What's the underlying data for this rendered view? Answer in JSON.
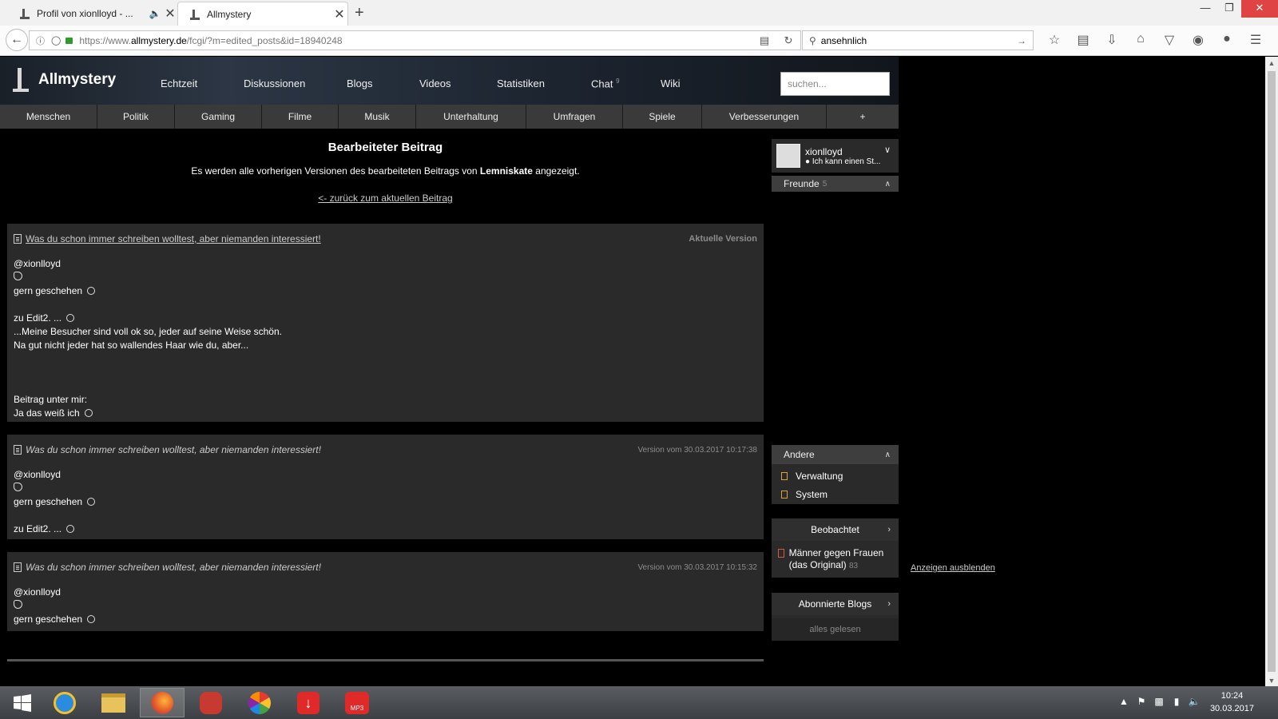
{
  "browser": {
    "tabs": [
      {
        "title": "Profil von xionlloyd - ...",
        "active": false
      },
      {
        "title": "Allmystery",
        "active": true
      }
    ],
    "url_prefix": "https://www.",
    "url_domain": "allmystery.de",
    "url_path": "/fcgi/?m=edited_posts&id=18940248",
    "search_value": "ansehnlich"
  },
  "site": {
    "logo": "Allmystery",
    "nav": [
      "Echtzeit",
      "Diskussionen",
      "Blogs",
      "Videos",
      "Statistiken",
      "Chat",
      "Wiki"
    ],
    "chat_count": "9",
    "search_placeholder": "suchen...",
    "categories": [
      "Menschen",
      "Politik",
      "Gaming",
      "Filme",
      "Musik",
      "Unterhaltung",
      "Umfragen",
      "Spiele",
      "Verbesserungen",
      "+"
    ]
  },
  "main": {
    "heading": "Bearbeiteter Beitrag",
    "info_before": "Es werden alle vorherigen Versionen des bearbeiteten Beitrags von ",
    "info_user": "Lemniskate",
    "info_after": " angezeigt.",
    "back_link": "<- zurück zum aktuellen Beitrag"
  },
  "posts": [
    {
      "title": "Was du schon immer schreiben wolltest, aber niemanden interessiert!",
      "version": "Aktuelle Version",
      "lines": [
        "@xionlloyd",
        "",
        "gern geschehen",
        "",
        "zu Edit2. ...",
        "...Meine Besucher sind voll ok so, jeder auf seine Weise schön.",
        "Na gut nicht jeder hat so wallendes Haar wie du, aber...",
        "",
        "",
        "",
        "Beitrag unter mir:",
        "Ja das weiß ich"
      ]
    },
    {
      "title": "Was du schon immer schreiben wolltest, aber niemanden interessiert!",
      "version": "Version vom 30.03.2017 10:17:38",
      "lines": [
        "@xionlloyd",
        "",
        "gern geschehen",
        "",
        "zu Edit2. ..."
      ]
    },
    {
      "title": "Was du schon immer schreiben wolltest, aber niemanden interessiert!",
      "version": "Version vom 30.03.2017 10:15:32",
      "lines": [
        "@xionlloyd",
        "",
        "gern geschehen"
      ]
    }
  ],
  "sidebar": {
    "username": "xionlloyd",
    "status": "● Ich kann einen St...",
    "friends_label": "Freunde",
    "friends_count": "5",
    "others_label": "Andere",
    "others_items": [
      "Verwaltung",
      "System"
    ],
    "watched_label": "Beobachtet",
    "watched_item": "Männer gegen Frauen (das Original)",
    "watched_count": "83",
    "blogs_label": "Abonnierte Blogs",
    "all_read": "alles gelesen",
    "hide_label": "Anzeigen ausblenden"
  },
  "taskbar": {
    "time": "10:24",
    "date": "30.03.2017"
  }
}
